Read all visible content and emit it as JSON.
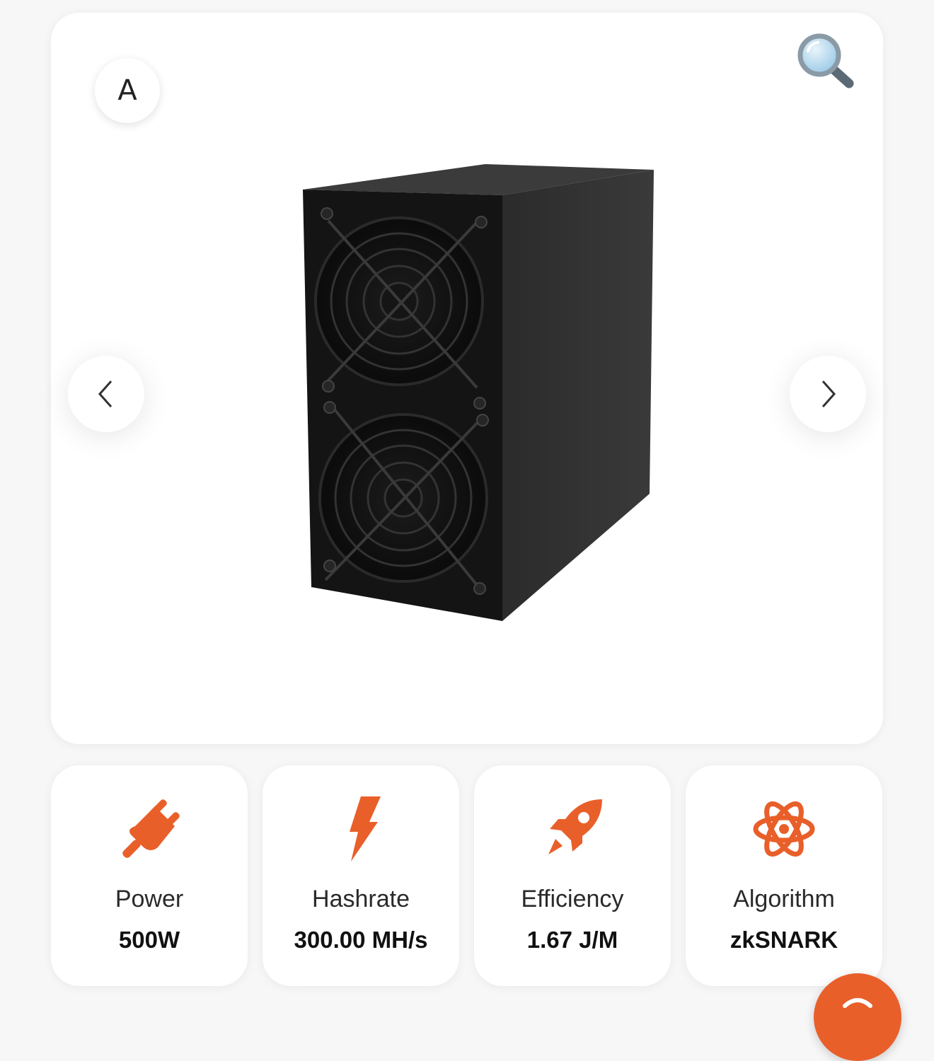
{
  "colors": {
    "accent": "#E95F2A",
    "card": "#FFFFFF",
    "background": "#F7F7F8"
  },
  "gallery": {
    "badge_letter": "A",
    "zoom_icon": "magnifier-icon",
    "prev_icon": "chevron-left-icon",
    "next_icon": "chevron-right-icon",
    "image": "asic-miner-dual-fan"
  },
  "specs": [
    {
      "icon": "plug-icon",
      "label": "Power",
      "value": "500W"
    },
    {
      "icon": "lightning-bolt-icon",
      "label": "Hashrate",
      "value": "300.00 MH/s"
    },
    {
      "icon": "rocket-icon",
      "label": "Efficiency",
      "value": "1.67 J/M"
    },
    {
      "icon": "atom-icon",
      "label": "Algorithm",
      "value": "zkSNARK"
    }
  ],
  "fab": {
    "icon": "chat-icon"
  }
}
